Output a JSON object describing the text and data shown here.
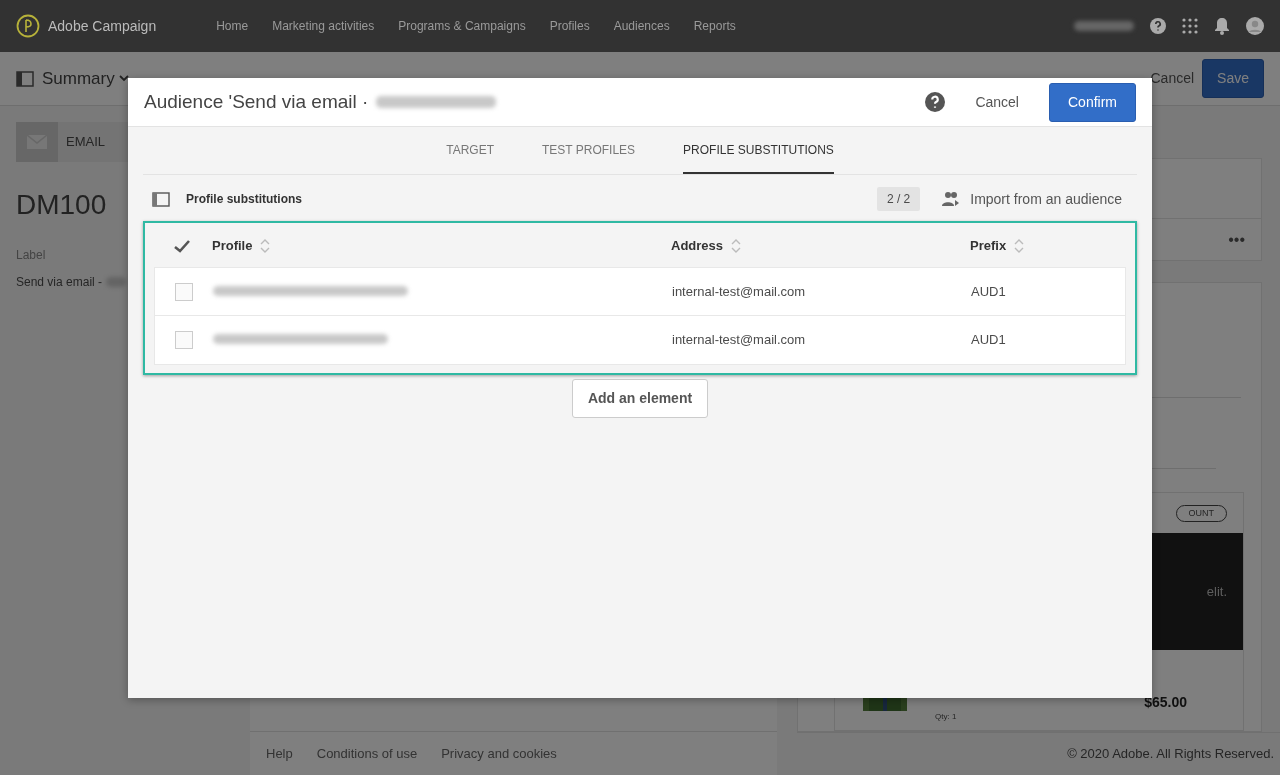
{
  "app": {
    "name": "Adobe Campaign"
  },
  "nav": [
    {
      "label": "Home"
    },
    {
      "label": "Marketing activities"
    },
    {
      "label": "Programs & Campaigns"
    },
    {
      "label": "Profiles"
    },
    {
      "label": "Audiences"
    },
    {
      "label": "Reports"
    }
  ],
  "page": {
    "summary": "Summary",
    "cancel": "Cancel",
    "save": "Save",
    "channel": "EMAIL",
    "code": "DM100",
    "label_caption": "Label",
    "label_value": "Send via email -",
    "more": "•••",
    "badge": "OUNT",
    "banner_text": "elit.",
    "product": {
      "qty": "Qty: 1",
      "price": "$65.00"
    }
  },
  "footer": {
    "links": [
      "Help",
      "Conditions of use",
      "Privacy and cookies"
    ],
    "copyright": "© 2020 Adobe. All Rights Reserved."
  },
  "dialog": {
    "title": "Audience 'Send via email ·",
    "cancel": "Cancel",
    "confirm": "Confirm",
    "tabs": [
      {
        "label": "TARGET",
        "selected": false
      },
      {
        "label": "TEST PROFILES",
        "selected": false
      },
      {
        "label": "PROFILE SUBSTITUTIONS",
        "selected": true
      }
    ],
    "section_title": "Profile substitutions",
    "count": "2 / 2",
    "import": "Import from an audience",
    "columns": [
      "Profile",
      "Address",
      "Prefix"
    ],
    "rows": [
      {
        "checked": false,
        "address": "internal-test@mail.com",
        "prefix": "AUD1"
      },
      {
        "checked": false,
        "address": "internal-test@mail.com",
        "prefix": "AUD1"
      }
    ],
    "add": "Add an element"
  }
}
